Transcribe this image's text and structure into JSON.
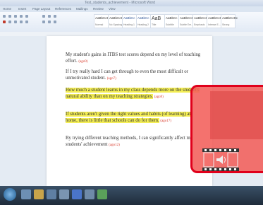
{
  "window": {
    "title": "Test_students_achievement - Microsoft Word"
  },
  "ribbon_tabs": [
    "Home",
    "Insert",
    "Page Layout",
    "References",
    "Mailings",
    "Review",
    "View"
  ],
  "styles": [
    {
      "sample": "AaBbCcDc",
      "name": "Normal"
    },
    {
      "sample": "AaBbCcDc",
      "name": "No Spacing"
    },
    {
      "sample": "AaBbCc",
      "name": "Heading 1"
    },
    {
      "sample": "AaBbCc",
      "name": "Heading 2"
    },
    {
      "sample": "AaB",
      "name": "Title"
    },
    {
      "sample": "AaBbCc",
      "name": "Subtitle"
    },
    {
      "sample": "AaBbCcDc",
      "name": "Subtle Em..."
    },
    {
      "sample": "AaBbCcDc",
      "name": "Emphasis"
    },
    {
      "sample": "AaBbCcDc",
      "name": "Intense E..."
    },
    {
      "sample": "AaBbCcDc",
      "name": "Strong"
    }
  ],
  "document": {
    "p1": {
      "text": "My student's gains in ITBS test scores depend on my level of teaching effort.",
      "ref": "(ago9)"
    },
    "p2": {
      "text": "If I try really hard I can get through to even the most difficult or unmotivated student.",
      "ref": "(ago7)"
    },
    "p3": {
      "text": "How much a student learns in my class depends more on the student's natural ability than on my teaching strategies.",
      "ref": "(ago9)"
    },
    "p4": {
      "text": "If students aren't given the right values and habits (of learning) at home, there is little that schools can do for them.",
      "ref": "(ago17)"
    },
    "p5": {
      "text": "By trying different teaching methods, I can significantly affect my students' achievement",
      "ref": "(ago12)"
    }
  },
  "overlay": {
    "accent": "#e0001b",
    "fill": "#f25f5a"
  }
}
